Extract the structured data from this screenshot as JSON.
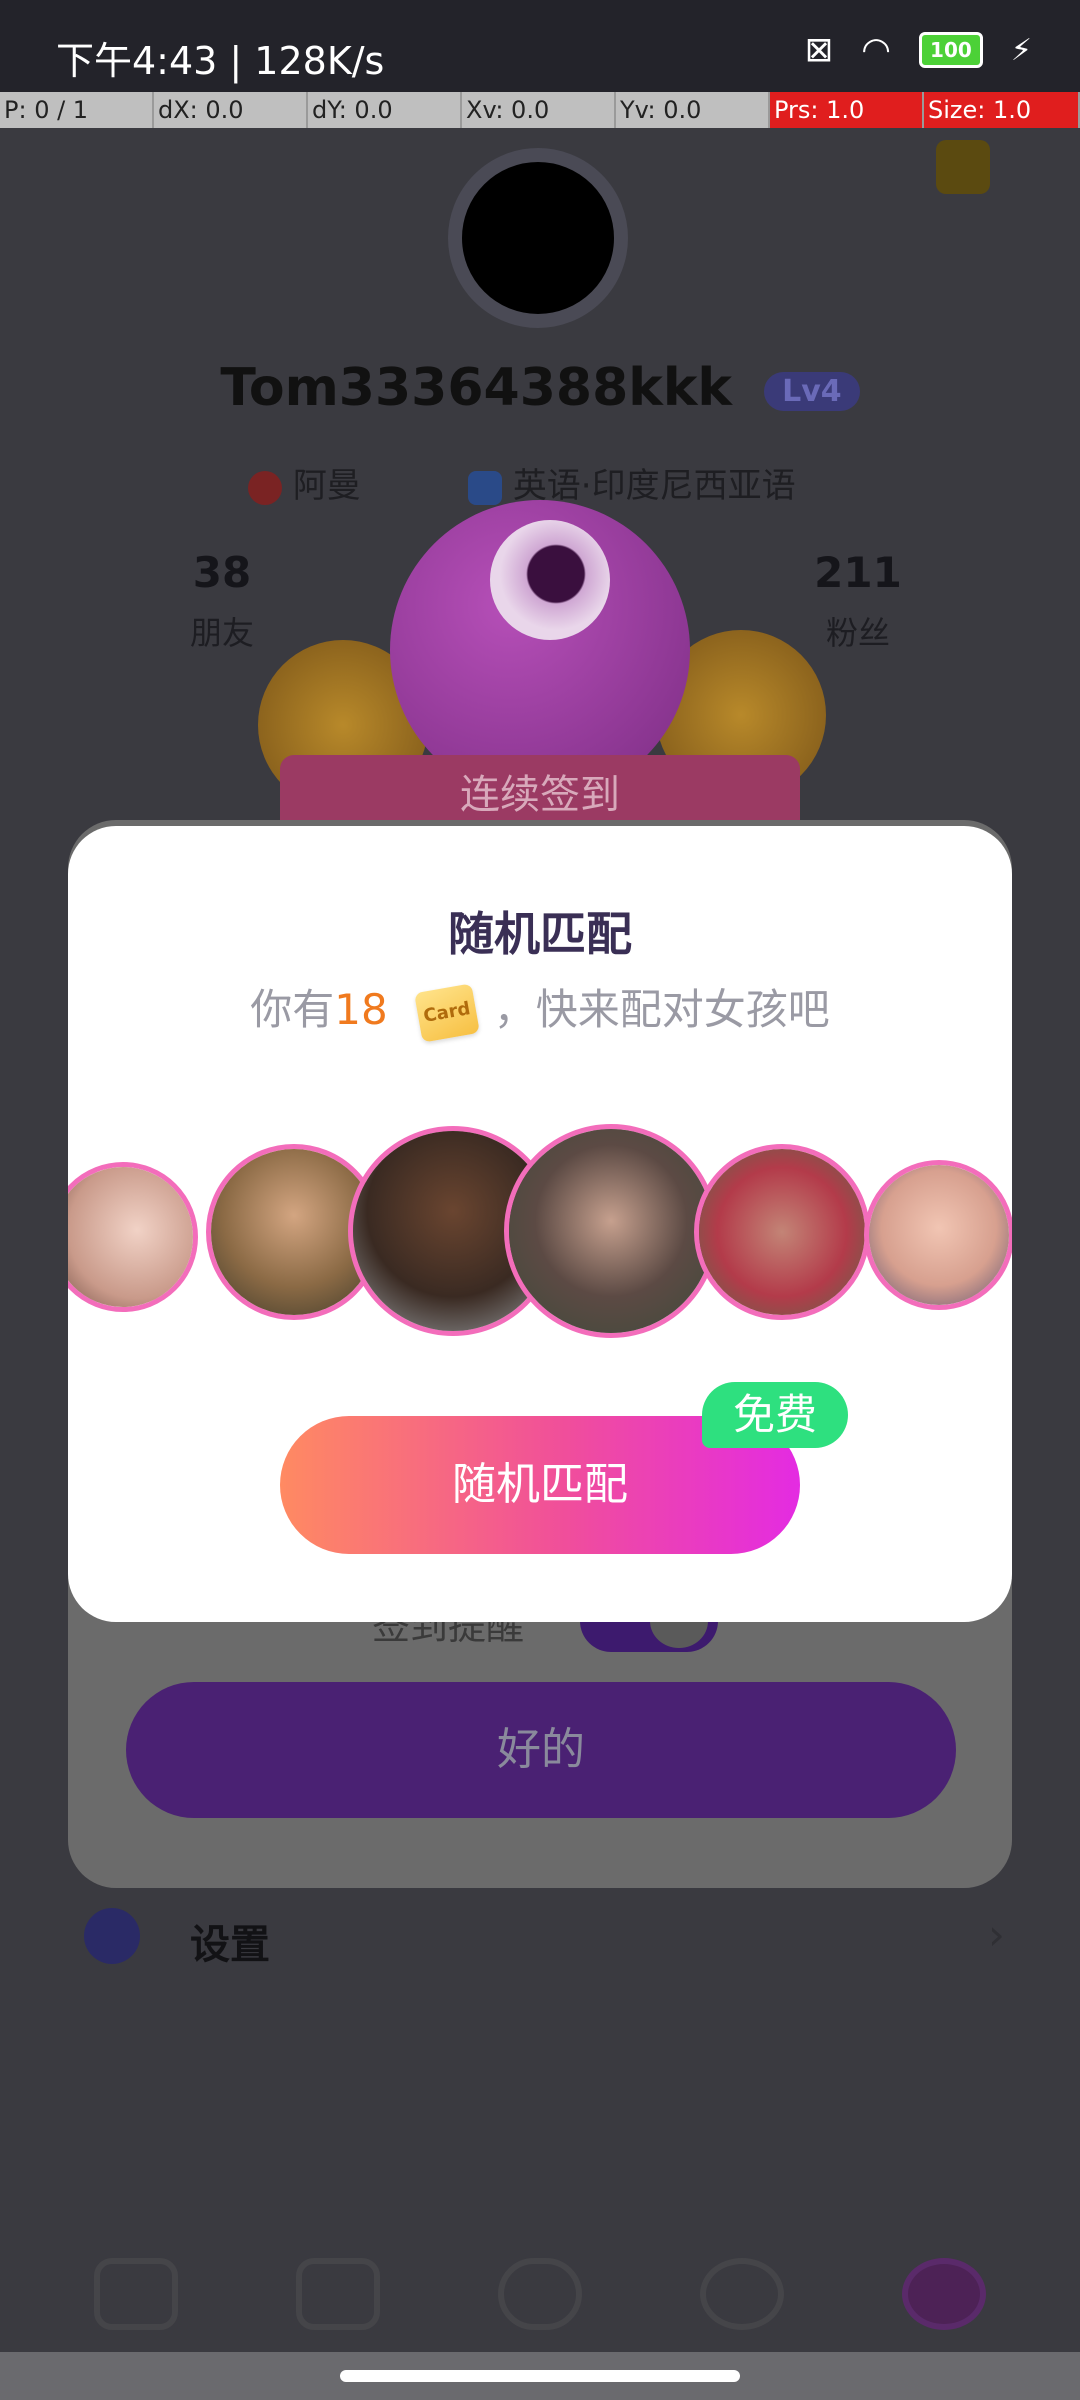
{
  "status_bar": {
    "time_speed": "下午4:43 | 128K/s",
    "battery": "100"
  },
  "debug_bar": [
    "P: 0 / 1",
    "dX: 0.0",
    "dY: 0.0",
    "Xv: 0.0",
    "Yv: 0.0",
    "Prs: 1.0",
    "Size: 1.0"
  ],
  "profile": {
    "username": "Tom33364388kkk",
    "level": "Lv4",
    "country": "阿曼",
    "languages": "英语·印度尼西亚语",
    "friends_count": "38",
    "friends_label": "朋友",
    "fans_count": "211",
    "fans_label": "粉丝"
  },
  "sign_in_banner": {
    "title": "连续签到"
  },
  "back_modal": {
    "reminder_label": "签到提醒",
    "ok_button": "好的"
  },
  "settings": {
    "label": "设置"
  },
  "dialog": {
    "title": "随机匹配",
    "subtitle_prefix": "你有",
    "card_count": "18",
    "card_icon_text": "Card",
    "subtitle_suffix": "，快来配对女孩吧",
    "match_button": "随机匹配",
    "free_badge": "免费"
  },
  "bottom_nav": [
    "video-call-icon",
    "tv-icon",
    "friends-icon",
    "planet-icon",
    "profile-icon"
  ]
}
